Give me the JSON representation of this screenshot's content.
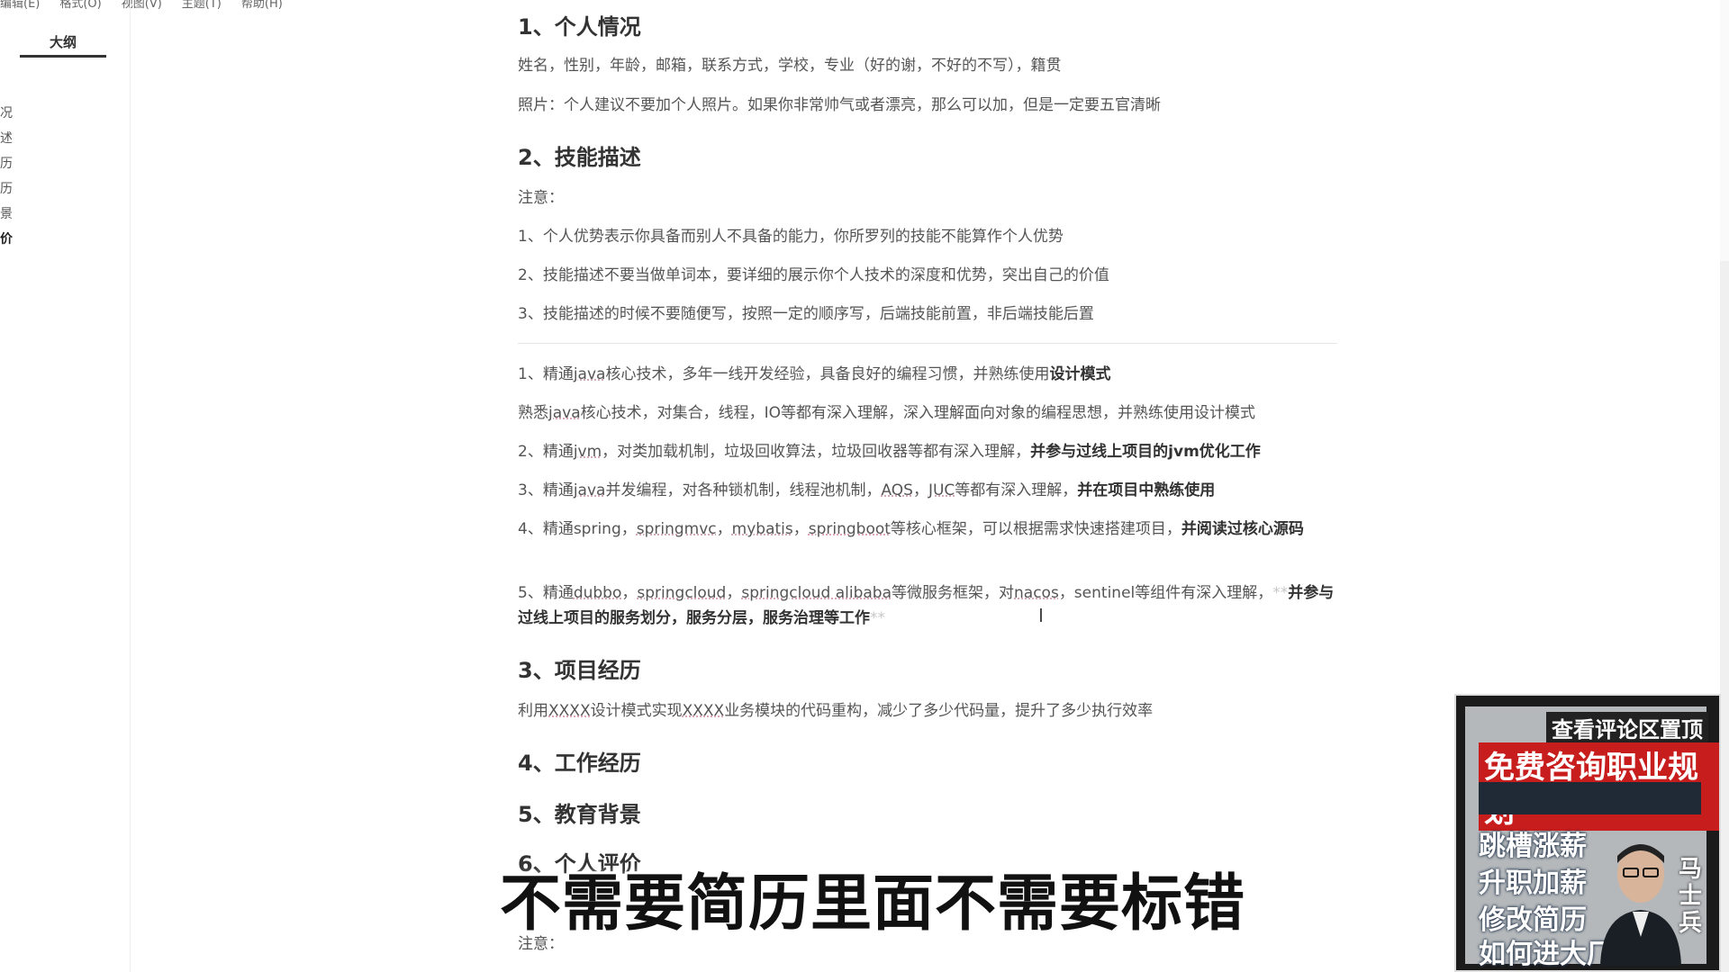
{
  "menu": [
    "编辑(E)",
    "格式(O)",
    "视图(V)",
    "主题(T)",
    "帮助(H)"
  ],
  "sidebar": {
    "tab": "大纲",
    "items": [
      {
        "label": "况",
        "bold": false
      },
      {
        "label": "述",
        "bold": false
      },
      {
        "label": "历",
        "bold": false
      },
      {
        "label": "历",
        "bold": false
      },
      {
        "label": "景",
        "bold": false
      },
      {
        "label": "价",
        "bold": true
      }
    ]
  },
  "doc": {
    "h1": "1、个人情况",
    "p1": "姓名，性别，年龄，邮箱，联系方式，学校，专业（好的谢，不好的不写），籍贯",
    "p2": "照片：个人建议不要加个人照片。如果你非常帅气或者漂亮，那么可以加，但是一定要五官清晰",
    "h2": "2、技能描述",
    "note": "注意：",
    "n1": "1、个人优势表示你具备而别人不具备的能力，你所罗列的技能不能算作个人优势",
    "n2": "2、技能描述不要当做单词本，要详细的展示你个人技术的深度和优势，突出自己的价值",
    "n3": "3、技能描述的时候不要随便写，按照一定的顺序写，后端技能前置，非后端技能后置",
    "s1": {
      "pre": "1、精通",
      "u1": "java",
      "mid": "核心技术，多年一线开发经验，具备良好的编程习惯，并熟练使用",
      "bold": "设计模式"
    },
    "s1b": {
      "pre": "熟悉",
      "u1": "java",
      "rest": "核心技术，对集合，线程，IO等都有深入理解，深入理解面向对象的编程思想，并熟练使用设计模式"
    },
    "s2": {
      "pre": "2、精通",
      "u1": "jvm",
      "mid": "，对类加载机制，垃圾回收算法，垃圾回收器等都有深入理解，",
      "bold": "并参与过线上项目的jvm优化工作"
    },
    "s3": {
      "pre": "3、精通",
      "u1": "java",
      "mid": "并发编程，对各种锁机制，线程池机制，",
      "u2": "AQS",
      "sep": "，",
      "u3": "JUC",
      "mid2": "等都有深入理解，",
      "bold": "并在项目中熟练使用"
    },
    "s4": {
      "pre": "4、精通spring，",
      "u1": "springmvc",
      "sep1": "，",
      "u2": "mybatis",
      "sep2": "，",
      "u3": "springboot",
      "mid": "等核心框架，可以根据需求快速搭建项目，",
      "bold": "并阅读过核心源码"
    },
    "s5": {
      "pre": "5、精通",
      "u1": "dubbo",
      "sep1": "，",
      "u2": "springcloud",
      "sep2": "，",
      "u3": "springcloud alibaba",
      "mid": "等微服务框架，对",
      "u4": "nacos",
      "mid2": "，sentinel等组件有深入理解，",
      "star": "**",
      "bold": "并参与过线上项目的服务划分，服务分层，服务治理等工作"
    },
    "h3": "3、项目经历",
    "p3": {
      "pre": "利用",
      "u1": "XXXX",
      "mid": "设计模式实现",
      "u2": "XXXX",
      "rest": "业务模块的代码重构，减少了多少代码量，提升了多少执行效率"
    },
    "h4": "4、工作经历",
    "h5": "5、教育背景",
    "h6": "6、个人评价",
    "note2": "注意："
  },
  "subtitle": "不需要简历里面不需要标错",
  "ad": {
    "top": "查看评论区置顶",
    "red": "免费咨询职业规划",
    "dark": "",
    "lines": [
      "跳槽涨薪",
      "升职加薪",
      "修改简历",
      "如何进大厂"
    ],
    "name": "马士兵"
  }
}
